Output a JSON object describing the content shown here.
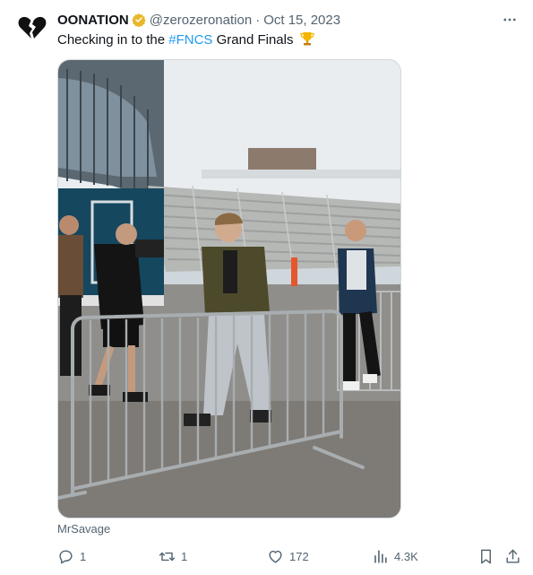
{
  "tweet": {
    "author_name": "OONATION",
    "handle": "@zerozeronation",
    "separator": "·",
    "date": "Oct 15, 2023",
    "text_before": "Checking in to the ",
    "hashtag": "#FNCS",
    "text_after": " Grand Finals",
    "media_credit": "MrSavage"
  },
  "actions": {
    "reply_count": "1",
    "retweet_count": "1",
    "like_count": "172",
    "view_count": "4.3K"
  },
  "icons": {
    "avatar": "broken-heart-logo",
    "verified": "gold-verified-badge",
    "more": "more-dots-icon",
    "reply": "reply-icon",
    "retweet": "retweet-icon",
    "like": "heart-icon",
    "views": "views-icon",
    "bookmark": "bookmark-icon",
    "share": "share-icon",
    "trophy": "trophy-emoji"
  },
  "colors": {
    "text": "#0f1419",
    "secondary": "#536471",
    "link": "#1d9bf0",
    "verified_gold": "#e8b62c"
  }
}
